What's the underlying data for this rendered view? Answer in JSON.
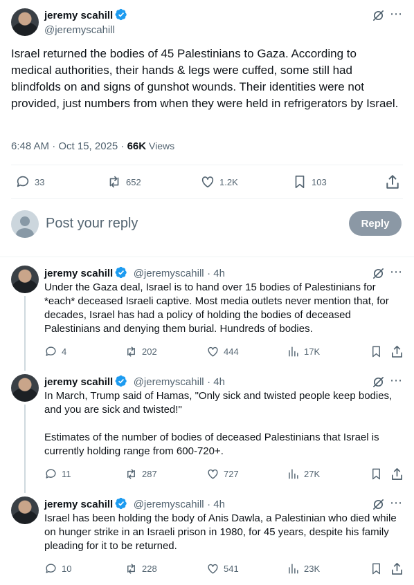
{
  "main_tweet": {
    "author_name": "jeremy scahill",
    "author_handle": "@jeremyscahill",
    "text": "Israel returned the bodies of 45 Palestinians to Gaza. According to medical authorities, their hands & legs were cuffed, some still had blindfolds on and signs of gunshot wounds. Their identities were not provided, just numbers from when they were held in refrigerators by Israel.",
    "timestamp": "6:48 AM · Oct 15, 2025 · ",
    "views_count": "66K",
    "views_label": " Views",
    "replies": "33",
    "reposts": "652",
    "likes": "1.2K",
    "bookmarks": "103"
  },
  "compose": {
    "placeholder": "Post your reply",
    "reply_button": "Reply"
  },
  "replies": [
    {
      "author_name": "jeremy scahill",
      "author_handle": "@jeremyscahill",
      "time": "· 4h",
      "text": "Under the Gaza deal, Israel is to hand over 15 bodies of Palestinians for *each* deceased Israeli captive. Most media outlets never mention that, for decades, Israel has had a policy of holding the bodies of deceased Palestinians and denying them burial. Hundreds of bodies.",
      "replies": "4",
      "reposts": "202",
      "likes": "444",
      "views": "17K"
    },
    {
      "author_name": "jeremy scahill",
      "author_handle": "@jeremyscahill",
      "time": "· 4h",
      "text_line1": "In March, Trump said of Hamas, \"Only sick and twisted people keep bodies, and you are sick and twisted!\"",
      "text_line2": "Estimates of the number of bodies of deceased Palestinians that Israel is currently holding range from 600-720+.",
      "replies": "11",
      "reposts": "287",
      "likes": "727",
      "views": "27K"
    },
    {
      "author_name": "jeremy scahill",
      "author_handle": "@jeremyscahill",
      "time": "· 4h",
      "text": "Israel has been holding the body of Anis Dawla, a Palestinian who died while on hunger strike in an Israeli prison in 1980, for 45 years, despite his family pleading for it to be returned.",
      "replies": "10",
      "reposts": "228",
      "likes": "541",
      "views": "23K"
    }
  ],
  "icons": {
    "more": "⋯",
    "accent": "#1d9bf0",
    "reply_button_color": "#8b98a5"
  }
}
